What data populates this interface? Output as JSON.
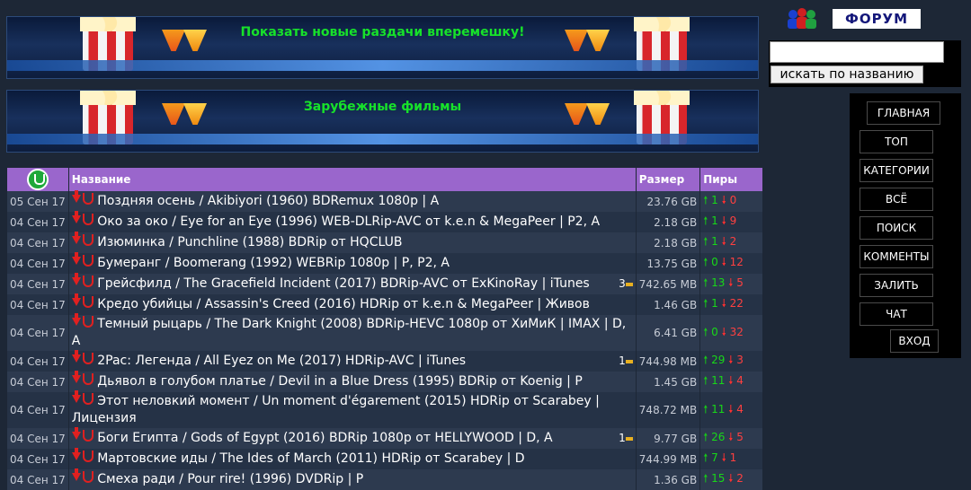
{
  "banners": [
    {
      "title": "Показать новые раздачи вперемешку!"
    },
    {
      "title": "Зарубежные фильмы"
    }
  ],
  "forum": {
    "label": "ФОРУМ"
  },
  "search": {
    "placeholder": "",
    "value": "",
    "button_label": "искать по названию"
  },
  "menu": [
    {
      "label": "ГЛАВНАЯ"
    },
    {
      "label": "ТОП"
    },
    {
      "label": "КАТЕГОРИИ"
    },
    {
      "label": "ВСЁ"
    },
    {
      "label": "ПОИСК"
    },
    {
      "label": "КОММЕНТЫ"
    },
    {
      "label": "ЗАЛИТЬ"
    },
    {
      "label": "ЧАТ"
    },
    {
      "label": "ВХОД"
    }
  ],
  "table": {
    "headers": {
      "name": "Название",
      "size": "Размер",
      "peers": "Пиры"
    },
    "rows": [
      {
        "date": "05 Сен 17",
        "name": "Поздняя осень / Akibiyori (1960) BDRemux 1080p | A",
        "comments": "",
        "size": "23.76 GB",
        "seeds": "1",
        "leech": "0"
      },
      {
        "date": "04 Сен 17",
        "name": "Око за око / Eye for an Eye (1996) WEB-DLRip-AVC от k.e.n & MegaPeer | P2, A",
        "comments": "",
        "size": "2.18 GB",
        "seeds": "1",
        "leech": "9"
      },
      {
        "date": "04 Сен 17",
        "name": "Изюминка / Punchline (1988) BDRip от HQCLUB",
        "comments": "",
        "size": "2.18 GB",
        "seeds": "1",
        "leech": "2"
      },
      {
        "date": "04 Сен 17",
        "name": "Бумеранг / Boomerang (1992) WEBRip 1080p | P, P2, A",
        "comments": "",
        "size": "13.75 GB",
        "seeds": "0",
        "leech": "12"
      },
      {
        "date": "04 Сен 17",
        "name": "Грейсфилд / The Gracefield Incident (2017) BDRip-AVC от ExKinoRay | iTunes",
        "comments": "3",
        "size": "742.65 MB",
        "seeds": "13",
        "leech": "5"
      },
      {
        "date": "04 Сен 17",
        "name": "Кредо убийцы / Assassin's Creed (2016) HDRip от k.e.n & MegaPeer | Живов",
        "comments": "",
        "size": "1.46 GB",
        "seeds": "1",
        "leech": "22"
      },
      {
        "date": "04 Сен 17",
        "name": "Темный рыцарь / The Dark Knight (2008) BDRip-HEVC 1080p от ХиМиК | IMAX | D, A",
        "comments": "",
        "size": "6.41 GB",
        "seeds": "0",
        "leech": "32"
      },
      {
        "date": "04 Сен 17",
        "name": "2Pac: Легенда / All Eyez on Me (2017) HDRip-AVC | iTunes",
        "comments": "1",
        "size": "744.98 MB",
        "seeds": "29",
        "leech": "3"
      },
      {
        "date": "04 Сен 17",
        "name": "Дьявол в голубом платье / Devil in a Blue Dress (1995) BDRip от Koenig | P",
        "comments": "",
        "size": "1.45 GB",
        "seeds": "11",
        "leech": "4"
      },
      {
        "date": "04 Сен 17",
        "name": "Этот неловкий момент / Un moment d'égarement (2015) HDRip от Scarabey | Лицензия",
        "comments": "",
        "size": "748.72 MB",
        "seeds": "11",
        "leech": "4"
      },
      {
        "date": "04 Сен 17",
        "name": "Боги Египта / Gods of Egypt (2016) BDRip 1080p от HELLYWOOD | D, A",
        "comments": "1",
        "size": "9.77 GB",
        "seeds": "26",
        "leech": "5"
      },
      {
        "date": "04 Сен 17",
        "name": "Мартовские иды / The Ides of March (2011) HDRip от Scarabey | D",
        "comments": "",
        "size": "744.99 MB",
        "seeds": "7",
        "leech": "1"
      },
      {
        "date": "04 Сен 17",
        "name": "Смеха ради / Pour rire! (1996) DVDRip | P",
        "comments": "",
        "size": "1.36 GB",
        "seeds": "15",
        "leech": "2"
      }
    ]
  },
  "colors": {
    "header_bg": "#9a66cc",
    "banner_title": "#17e22a",
    "seed": "#18c818",
    "leech": "#ff3030"
  }
}
